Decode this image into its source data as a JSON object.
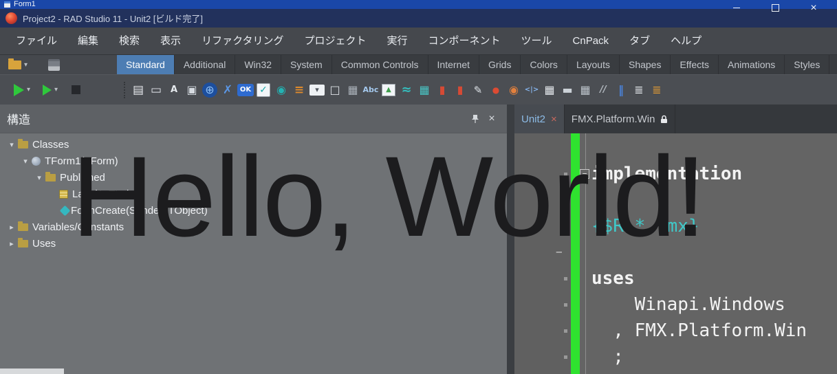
{
  "window": {
    "mini_title": "Form1",
    "title": "Project2 - RAD Studio 11 - Unit2 [ビルド完了]"
  },
  "menubar": {
    "items": [
      "ファイル",
      "編集",
      "検索",
      "表示",
      "リファクタリング",
      "プロジェクト",
      "実行",
      "コンポーネント",
      "ツール",
      "CnPack",
      "タブ",
      "ヘルプ"
    ]
  },
  "palette": {
    "active_tab": "Standard",
    "tabs": [
      "Standard",
      "Additional",
      "Win32",
      "System",
      "Common Controls",
      "Internet",
      "Grids",
      "Colors",
      "Layouts",
      "Shapes",
      "Effects",
      "Animations",
      "Styles"
    ]
  },
  "toolbar2": {
    "icons": [
      {
        "name": "form-window-icon",
        "glyph": "▤",
        "style": "color:#e8ebef;font-size:17px"
      },
      {
        "name": "edit-field-icon",
        "glyph": "▭",
        "style": "color:#e0e4e9;font-size:17px"
      },
      {
        "name": "label-edit-icon",
        "glyph": "A",
        "style": "color:#e6eaee;font-size:13px;font-weight:bold"
      },
      {
        "name": "layers-icon",
        "glyph": "▣",
        "style": "color:#d6dbe1;font-size:16px"
      },
      {
        "name": "globe-icon",
        "glyph": "⊕",
        "style": "background:#1d4f9e;color:#8fc0f4;border-radius:50%;font-size:16px;width:22px;height:22px;margin:2px"
      },
      {
        "name": "blue-x-icon",
        "glyph": "✗",
        "style": "color:#5b97e6;font-size:17px;font-weight:bold"
      },
      {
        "name": "ok-button-icon",
        "glyph": "OK",
        "style": "background:#2e6bd0;color:#ffffff;font-size:10px;font-weight:bold;border-radius:3px;width:24px;height:18px;margin:4px 1px"
      },
      {
        "name": "checkbox-icon",
        "glyph": "✓",
        "style": "background:#f2f5f8;color:#14a7a7;border:1px solid #99a0a7;font-size:14px;width:20px;height:20px;margin:3px;border-radius:2px"
      },
      {
        "name": "radio-button-icon",
        "glyph": "◉",
        "style": "color:#23b3b3;font-size:16px"
      },
      {
        "name": "listbox-icon",
        "glyph": "≡",
        "style": "color:#df8b2c;font-size:17px;font-weight:bold"
      },
      {
        "name": "combobox-icon",
        "glyph": "▾",
        "style": "background:#eef1f4;color:#50565e;font-size:11px;width:22px;height:16px;margin:5px 2px;border-radius:2px"
      },
      {
        "name": "panel-icon",
        "glyph": "□",
        "style": "color:#dde1e6;font-size:16px"
      },
      {
        "name": "grid-panel-icon",
        "glyph": "▦",
        "style": "color:#aab1b9;font-size:16px"
      },
      {
        "name": "label-abc-icon",
        "glyph": "Abc",
        "style": "color:#a5c9ee;font-size:11px;font-weight:bold"
      },
      {
        "name": "image-icon",
        "glyph": "▲",
        "style": "background:#f1f4f7;color:#3e9e4b;border:1px solid #979ea5;font-size:10px;width:20px;height:18px;margin:4px 3px"
      },
      {
        "name": "path-icon",
        "glyph": "≈",
        "style": "color:#35bdbd;font-size:18px;font-weight:bold"
      },
      {
        "name": "chart-grid-icon",
        "glyph": "▦",
        "style": "color:#49c3c3;font-size:16px"
      },
      {
        "name": "progress-red-icon",
        "glyph": "▮",
        "style": "color:#d64a35;font-size:16px"
      },
      {
        "name": "track-red-icon",
        "glyph": "▮",
        "style": "color:#d64a35;font-size:16px"
      },
      {
        "name": "edit-note-icon",
        "glyph": "✎",
        "style": "color:#dde2e7;font-size:15px"
      },
      {
        "name": "slider-icon",
        "glyph": "●",
        "style": "color:#dc4b33;font-size:12px"
      },
      {
        "name": "switch-icon",
        "glyph": "◉",
        "style": "color:#e2803d;font-size:16px"
      },
      {
        "name": "code-brackets-icon",
        "glyph": "<|>",
        "style": "color:#85b4ec;font-size:10px;font-weight:bold"
      },
      {
        "name": "header-grid-icon",
        "glyph": "▦",
        "style": "color:#e3e7eb;font-size:16px"
      },
      {
        "name": "progressbar-icon",
        "glyph": "▬",
        "style": "color:#ccd2d8;font-size:16px"
      },
      {
        "name": "table-view-icon",
        "glyph": "▦",
        "style": "color:#bcc3ca;font-size:16px"
      },
      {
        "name": "splitter-icon",
        "glyph": "//",
        "style": "color:#b4bac1;font-size:13px;font-weight:bold;font-style:italic"
      },
      {
        "name": "columns-icon",
        "glyph": "‖",
        "style": "color:#4b7fd2;font-size:16px;font-weight:bold"
      },
      {
        "name": "list-view-icon",
        "glyph": "≣",
        "style": "color:#e4e8ec;font-size:16px"
      },
      {
        "name": "memo-icon",
        "glyph": "≣",
        "style": "color:#e09a35;font-size:16px"
      }
    ]
  },
  "structure": {
    "title": "構造",
    "items": [
      {
        "label": "Classes",
        "icon": "folder",
        "state": "expanded",
        "depth": 0
      },
      {
        "label": "TForm1(TForm)",
        "icon": "class",
        "state": "expanded",
        "depth": 1
      },
      {
        "label": "Published",
        "icon": "folder",
        "state": "expanded",
        "depth": 2
      },
      {
        "label": "Label1: TLabel",
        "icon": "label",
        "state": "leaf",
        "depth": 3
      },
      {
        "label": "FormCreate(Sender: TObject)",
        "icon": "method",
        "state": "leaf",
        "depth": 3
      },
      {
        "label": "Variables/Constants",
        "icon": "folder",
        "state": "collapsed",
        "depth": 0
      },
      {
        "label": "Uses",
        "icon": "folder",
        "state": "collapsed",
        "depth": 0
      }
    ]
  },
  "editor": {
    "tabs": [
      {
        "label": "Unit2",
        "active": true,
        "closable": true
      },
      {
        "label": "FMX.Platform.Win",
        "active": false,
        "locked": true
      }
    ],
    "lines": [
      {
        "text": "implementation",
        "type": "keyword"
      },
      {
        "text": "",
        "type": "blank"
      },
      {
        "text": "{$R *.fmx}",
        "type": "directive"
      },
      {
        "text": "",
        "type": "blank"
      },
      {
        "text": "uses",
        "type": "keyword"
      },
      {
        "text": "    Winapi.Windows",
        "type": "code"
      },
      {
        "text": "  , FMX.Platform.Win",
        "type": "code"
      },
      {
        "text": "  ;",
        "type": "code"
      }
    ]
  },
  "overlay": {
    "text": "Hello, World!"
  },
  "colors": {
    "accent_blue": "#4d7db3",
    "modified_bar_green": "#2fe22f",
    "directive_teal": "#3fc9c9",
    "titlebar_navy": "#22315c",
    "mini_titlebar_blue": "#1a47a8"
  }
}
